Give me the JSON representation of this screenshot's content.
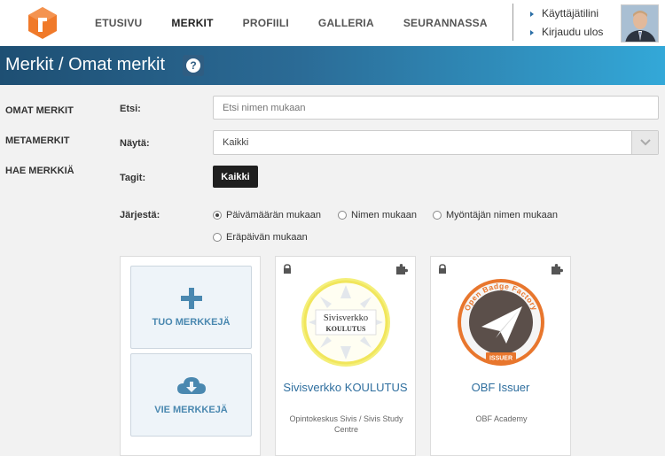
{
  "nav": {
    "items": [
      "ETUSIVU",
      "MERKIT",
      "PROFIILI",
      "GALLERIA",
      "SEURANNASSA"
    ],
    "active": "MERKIT",
    "account_link": "Käyttäjätilini",
    "logout_link": "Kirjaudu ulos",
    "logo_icon": "open-badge-passport-logo-icon",
    "brand_color": "#f07a2a"
  },
  "title": {
    "text": "Merkit / Omat merkit",
    "help_glyph": "?"
  },
  "sidebar": {
    "items": [
      "OMAT MERKIT",
      "METAMERKIT",
      "HAE MERKKIÄ"
    ]
  },
  "filters": {
    "search_label": "Etsi:",
    "search_placeholder": "Etsi nimen mukaan",
    "show_label": "Näytä:",
    "show_value": "Kaikki",
    "tags_label": "Tagit:",
    "tags_button": "Kaikki",
    "sort_label": "Järjestä:",
    "sort_options": [
      "Päivämäärän mukaan",
      "Nimen mukaan",
      "Myöntäjän nimen mukaan",
      "Eräpäivän mukaan"
    ],
    "sort_selected": 0
  },
  "actions": {
    "import_label": "TUO MERKKEJÄ",
    "export_label": "VIE MERKKEJÄ"
  },
  "badges": [
    {
      "name": "Sivisverkko KOULUTUS",
      "issuer": "Opintokeskus Sivis / Sivis Study Centre",
      "badge_line1": "Sivisverkko",
      "badge_line2": "KOULUTUS"
    },
    {
      "name": "OBF Issuer",
      "issuer": "OBF Academy",
      "ring_text": "Open Badge Factory",
      "ribbon_text": "ISSUER"
    }
  ],
  "colors": {
    "accent_blue": "#2e6e9e",
    "title_gradient_start": "#1e4f73",
    "title_gradient_end": "#33a8d8",
    "obf_orange": "#e8762d"
  }
}
